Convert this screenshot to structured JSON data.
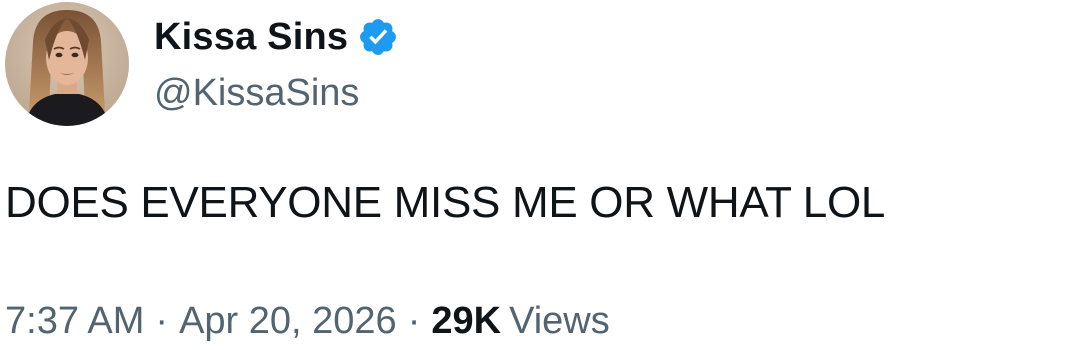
{
  "author": {
    "display_name": "Kissa Sins",
    "handle": "@KissaSins",
    "verified": true,
    "avatar_icon": "profile-photo",
    "verified_icon": "verified-badge-icon",
    "verified_color": "#1d9bf0"
  },
  "tweet": {
    "text": "DOES EVERYONE MISS ME OR WHAT LOL"
  },
  "meta": {
    "time": "7:37 AM",
    "separator": "·",
    "date": "Apr 20, 2026",
    "views_count": "29K",
    "views_label": "Views"
  },
  "colors": {
    "text_primary": "#0f1419",
    "text_secondary": "#536471",
    "background": "#ffffff"
  }
}
